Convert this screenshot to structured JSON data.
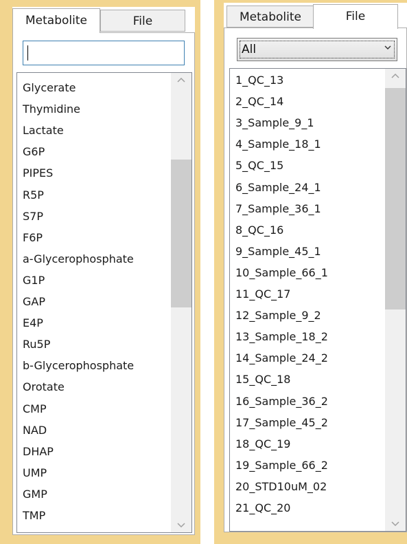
{
  "left_panel": {
    "tabs": [
      {
        "label": "Metabolite",
        "active": true
      },
      {
        "label": "File",
        "active": false
      }
    ],
    "search": {
      "value": "",
      "placeholder": ""
    },
    "items": [
      "Glycerate",
      "Thymidine",
      "Lactate",
      "G6P",
      "PIPES",
      "R5P",
      "S7P",
      "F6P",
      "a-Glycerophosphate",
      "G1P",
      "GAP",
      "E4P",
      "Ru5P",
      "b-Glycerophosphate",
      "Orotate",
      "CMP",
      "NAD",
      "DHAP",
      "UMP",
      "GMP",
      "TMP"
    ]
  },
  "right_panel": {
    "tabs": [
      {
        "label": "Metabolite",
        "active": false
      },
      {
        "label": "File",
        "active": true
      }
    ],
    "filter": {
      "selected": "All"
    },
    "items": [
      "1_QC_13",
      "2_QC_14",
      "3_Sample_9_1",
      "4_Sample_18_1",
      "5_QC_15",
      "6_Sample_24_1",
      "7_Sample_36_1",
      "8_QC_16",
      "9_Sample_45_1",
      "10_Sample_66_1",
      "11_QC_17",
      "12_Sample_9_2",
      "13_Sample_18_2",
      "14_Sample_24_2",
      "15_QC_18",
      "16_Sample_36_2",
      "17_Sample_45_2",
      "18_QC_19",
      "19_Sample_66_2",
      "20_STD10uM_02",
      "21_QC_20"
    ]
  },
  "colors": {
    "frame": "#f2d58f",
    "focus_border": "#3c7fb1",
    "scroll_thumb": "#cdcdcd"
  },
  "icons": [
    "chevron-up-icon",
    "chevron-down-icon",
    "dropdown-arrow-icon"
  ]
}
